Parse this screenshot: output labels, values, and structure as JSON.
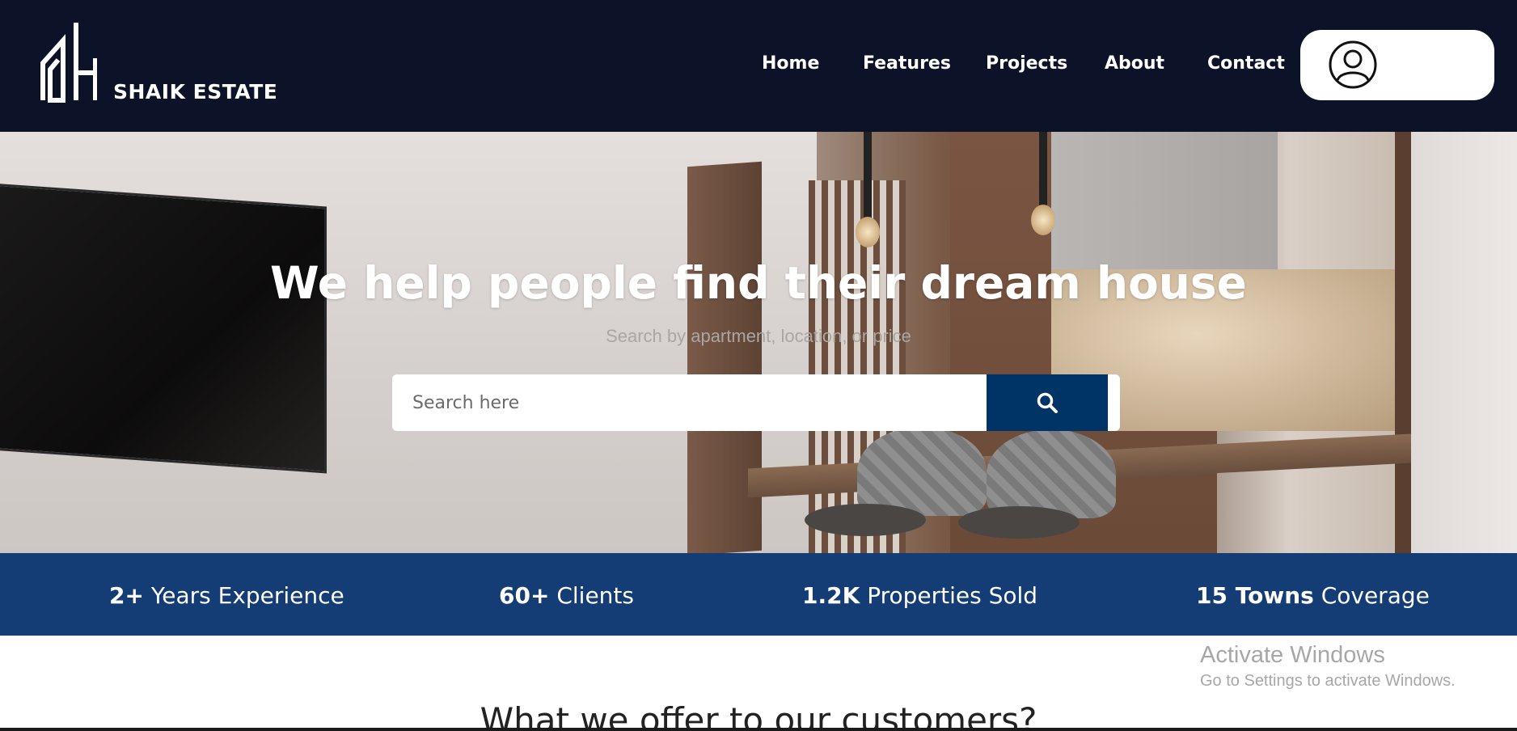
{
  "header": {
    "brand": "SHAIK ESTATE",
    "nav": [
      "Home",
      "Features",
      "Projects",
      "About",
      "Contact"
    ],
    "profile_icon": "user-circle-icon"
  },
  "hero": {
    "title": "We help people find their dream house",
    "subtitle": "Search by apartment, location, or price",
    "search_placeholder": "Search here",
    "search_icon": "search-icon"
  },
  "stats": [
    {
      "value": "2+",
      "label": "Years Experience"
    },
    {
      "value": "60+",
      "label": "Clients"
    },
    {
      "value": "1.2K",
      "label": "Properties Sold"
    },
    {
      "value": "15 Towns",
      "label": "Coverage"
    }
  ],
  "offer": {
    "title": "What we offer to our customers?"
  },
  "watermark": {
    "line1": "Activate Windows",
    "line2": "Go to Settings to activate Windows."
  },
  "colors": {
    "header_bg": "#0c1227",
    "stats_bg": "#133d74",
    "search_button": "#003366"
  }
}
